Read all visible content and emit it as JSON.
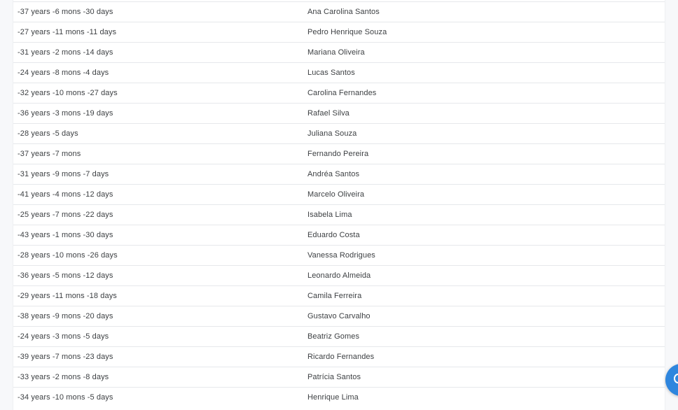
{
  "table": {
    "rows": [
      {
        "age": "-37 years -6 mons -30 days",
        "name": "Ana Carolina Santos"
      },
      {
        "age": "-27 years -11 mons -11 days",
        "name": "Pedro Henrique Souza"
      },
      {
        "age": "-31 years -2 mons -14 days",
        "name": "Mariana Oliveira"
      },
      {
        "age": "-24 years -8 mons -4 days",
        "name": "Lucas Santos"
      },
      {
        "age": "-32 years -10 mons -27 days",
        "name": "Carolina Fernandes"
      },
      {
        "age": "-36 years -3 mons -19 days",
        "name": "Rafael Silva"
      },
      {
        "age": "-28 years -5 days",
        "name": "Juliana Souza"
      },
      {
        "age": "-37 years -7 mons",
        "name": "Fernando Pereira"
      },
      {
        "age": "-31 years -9 mons -7 days",
        "name": "Andréa Santos"
      },
      {
        "age": "-41 years -4 mons -12 days",
        "name": "Marcelo Oliveira"
      },
      {
        "age": "-25 years -7 mons -22 days",
        "name": "Isabela Lima"
      },
      {
        "age": "-43 years -1 mons -30 days",
        "name": "Eduardo Costa"
      },
      {
        "age": "-28 years -10 mons -26 days",
        "name": "Vanessa Rodrigues"
      },
      {
        "age": "-36 years -5 mons -12 days",
        "name": "Leonardo Almeida"
      },
      {
        "age": "-29 years -11 mons -18 days",
        "name": "Camila Ferreira"
      },
      {
        "age": "-38 years -9 mons -20 days",
        "name": "Gustavo Carvalho"
      },
      {
        "age": "-24 years -3 mons -5 days",
        "name": "Beatriz Gomes"
      },
      {
        "age": "-39 years -7 mons -23 days",
        "name": "Ricardo Fernandes"
      },
      {
        "age": "-33 years -2 mons -8 days",
        "name": "Patrícia Santos"
      },
      {
        "age": "-34 years -10 mons -5 days",
        "name": "Henrique Lima"
      }
    ]
  },
  "fab": {
    "icon": "chat-icon",
    "color": "#2f86de"
  }
}
